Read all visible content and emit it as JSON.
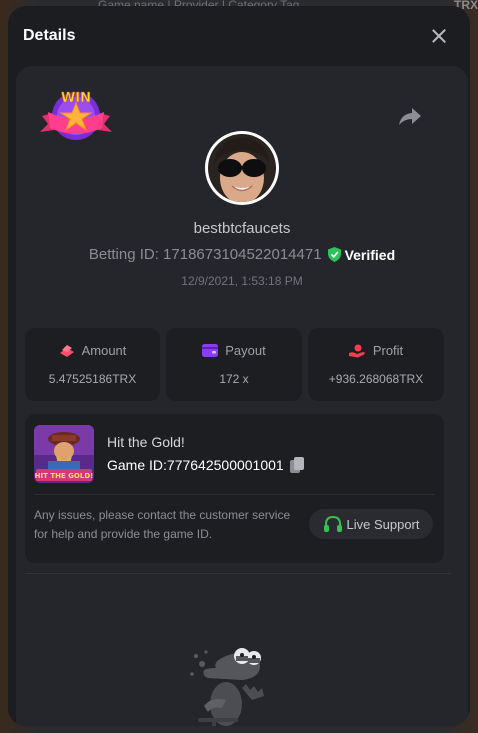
{
  "background": {
    "search_placeholder": "Game name | Provider | Category Tag",
    "currency": "TRX"
  },
  "modal": {
    "title": "Details",
    "close_icon": "close-icon"
  },
  "bet": {
    "badge": "WIN",
    "username": "bestbtcfaucets",
    "betting_id": "Betting ID: 1718673104522014471",
    "verified_label": "Verified",
    "timestamp": "12/9/2021, 1:53:18 PM"
  },
  "stats": {
    "amount_label": "Amount",
    "amount_value": "5.47525186TRX",
    "payout_label": "Payout",
    "payout_value": "172 x",
    "profit_label": "Profit",
    "profit_value": "+936.268068TRX"
  },
  "game": {
    "name": "Hit the Gold!",
    "game_id": "Game ID:777642500001001",
    "thumb_text": "HIT THE GOLD!",
    "issue_text": "Any issues, please contact the customer service for help and provide the game ID.",
    "support_label": "Live Support"
  },
  "colors": {
    "verified_green": "#2fc25b",
    "amount_pink": "#ff4d6d",
    "payout_purple": "#8b3cf7",
    "profit_red": "#ff3b4e",
    "support_green": "#36c24f"
  }
}
